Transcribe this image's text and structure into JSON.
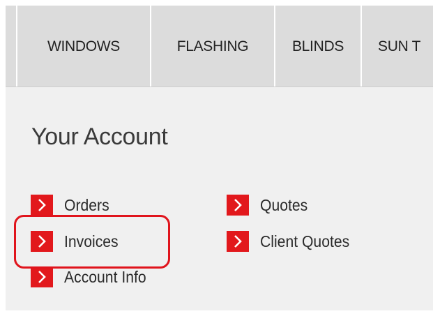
{
  "nav": {
    "items": [
      {
        "label": "WINDOWS"
      },
      {
        "label": "FLASHING"
      },
      {
        "label": "BLINDS"
      },
      {
        "label": "SUN T"
      }
    ]
  },
  "account": {
    "title": "Your Account",
    "links": {
      "orders": "Orders",
      "invoices": "Invoices",
      "account_info": "Account Info",
      "quotes": "Quotes",
      "client_quotes": "Client Quotes"
    }
  },
  "colors": {
    "accent_red": "#e2181c",
    "highlight_red": "#e0141c",
    "nav_bg": "#dcdcdc",
    "content_bg": "#f0f0f0"
  },
  "icons": {
    "link_arrow": "chevron-right-icon"
  }
}
